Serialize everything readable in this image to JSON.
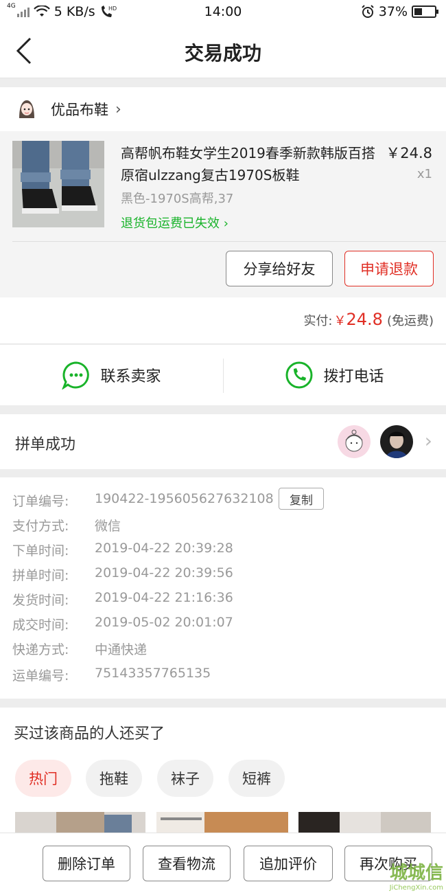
{
  "status_bar": {
    "network": "4G",
    "speed": "5 KB/s",
    "hd": "HD",
    "time": "14:00",
    "battery": "37%"
  },
  "nav": {
    "title": "交易成功"
  },
  "shop": {
    "name": "优品布鞋"
  },
  "goods": {
    "title": "高帮帆布鞋女学生2019春季新款韩版百搭原宿ulzzang复古1970S板鞋",
    "price": "￥24.8",
    "qty": "x1",
    "spec": "黑色-1970S高帮,37",
    "return_notice": "退货包运费已失效",
    "share_label": "分享给好友",
    "refund_label": "申请退款"
  },
  "payment": {
    "label": "实付:",
    "currency": "￥",
    "amount": "24.8",
    "note": "(免运费)"
  },
  "contact": {
    "seller_label": "联系卖家",
    "call_label": "拨打电话"
  },
  "group": {
    "label": "拼单成功"
  },
  "order_info": {
    "copy_label": "复制",
    "rows": [
      {
        "key": "订单编号:",
        "value": "190422-195605627632108"
      },
      {
        "key": "支付方式:",
        "value": "微信"
      },
      {
        "key": "下单时间:",
        "value": "2019-04-22 20:39:28"
      },
      {
        "key": "拼单时间:",
        "value": "2019-04-22 20:39:56"
      },
      {
        "key": "发货时间:",
        "value": "2019-04-22 21:16:36"
      },
      {
        "key": "成交时间:",
        "value": "2019-05-02 20:01:07"
      },
      {
        "key": "快递方式:",
        "value": "中通快递"
      },
      {
        "key": "运单编号:",
        "value": "75143357765135"
      }
    ]
  },
  "recommend": {
    "title": "买过该商品的人还买了",
    "chips": [
      "热门",
      "拖鞋",
      "袜子",
      "短裤"
    ]
  },
  "bottom_bar": {
    "delete_label": "删除订单",
    "logistics_label": "查看物流",
    "review_label": "追加评价",
    "rebuy_label": "再次购买"
  },
  "watermark": {
    "main": "城城信",
    "sub": "JiChengXin.com"
  },
  "colors": {
    "accent": "#e02e24",
    "green": "#19b32a"
  }
}
